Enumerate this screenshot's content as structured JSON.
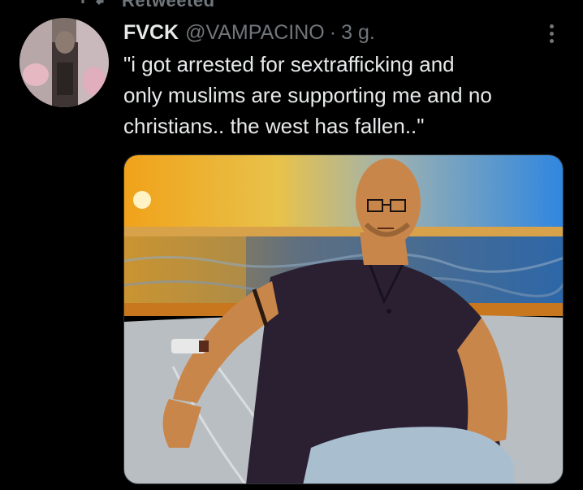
{
  "retweet_bar": {
    "text": "Retweeted"
  },
  "tweet": {
    "display_name": "FVCK",
    "handle": "@VAMPACINO",
    "separator": "·",
    "timestamp": "3 g.",
    "text": "\"i got arrested for sextrafficking and\nonly muslims are supporting me and no\nchristians.. the west has fallen..\""
  },
  "icons": {
    "retweet": "retweet-icon",
    "more": "more-options-icon"
  },
  "colors": {
    "background": "#000000",
    "primary_text": "#e7e9ea",
    "secondary_text": "#71767b",
    "border": "#2f3336"
  }
}
